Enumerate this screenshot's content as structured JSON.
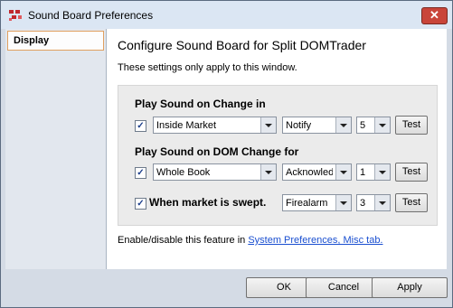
{
  "window": {
    "title": "Sound Board Preferences",
    "close_glyph": "✕"
  },
  "sidebar": {
    "items": [
      {
        "label": "Display",
        "selected": true
      }
    ]
  },
  "main": {
    "heading": "Configure Sound Board for Split DOMTrader",
    "subtext": "These settings only apply to this window.",
    "section1": {
      "label": "Play Sound on Change in",
      "checked": true,
      "market": "Inside Market",
      "sound": "Notify",
      "repeat": "5",
      "test_label": "Test"
    },
    "section2": {
      "label": "Play Sound on DOM Change for",
      "checked": true,
      "book": "Whole Book",
      "sound": "Acknowledge",
      "repeat": "1",
      "test_label": "Test"
    },
    "section3": {
      "label": "When market is swept.",
      "checked": true,
      "sound": "Firealarm",
      "repeat": "3",
      "test_label": "Test"
    },
    "footer_text": "Enable/disable this feature in ",
    "footer_link": "System Preferences, Misc tab."
  },
  "buttons": {
    "ok": "OK",
    "cancel": "Cancel",
    "apply": "Apply"
  },
  "colors": {
    "accent_link": "#1a4fd0",
    "selected_border": "#e0a060",
    "titlebar": "#dbe6f3"
  },
  "icons": {
    "app": "sound-board-app-icon",
    "close": "close-icon",
    "checkbox": "checkmark-icon",
    "dropdown": "chevron-down-icon"
  }
}
